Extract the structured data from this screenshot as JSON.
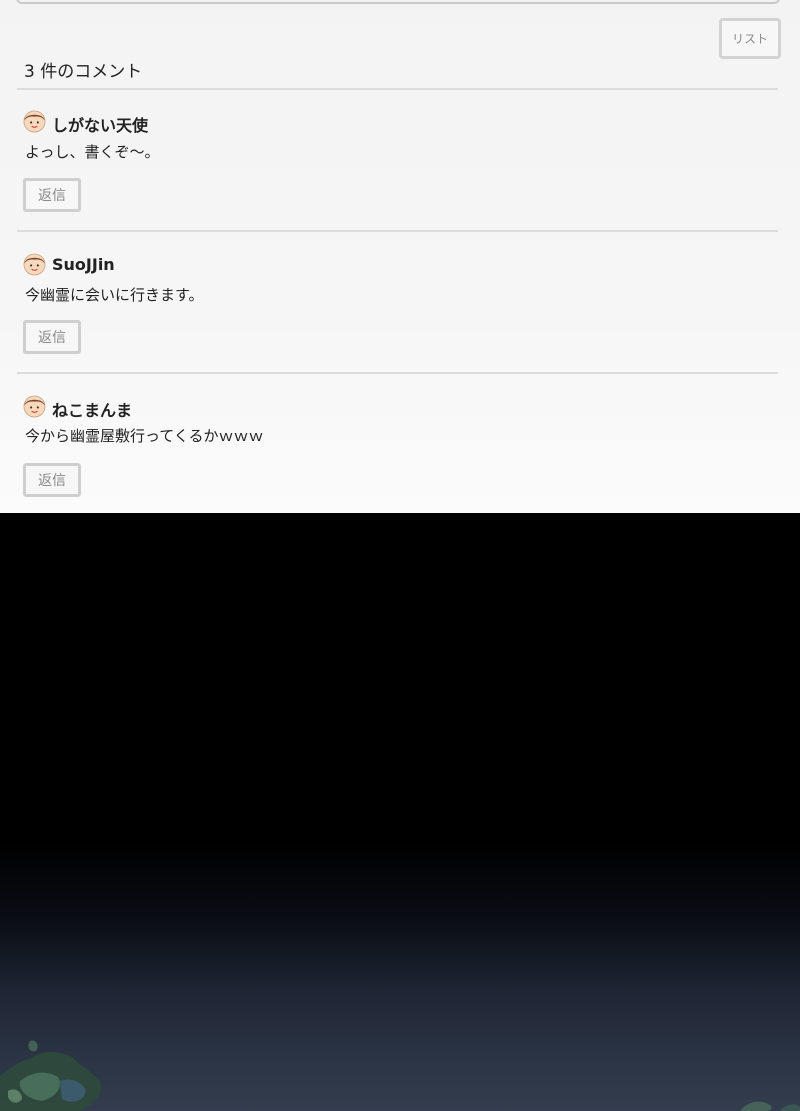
{
  "list_button_label": "リスト",
  "comment_count_title": "3 件のコメント",
  "comments": [
    {
      "author": "しがない天使",
      "text": "よっし、書くぞ〜。",
      "reply_label": "返信"
    },
    {
      "author": "SuoJJin",
      "text": "今幽霊に会いに行きます。",
      "reply_label": "返信"
    },
    {
      "author": "ねこまんま",
      "text": "今から幽霊屋敷行ってくるかｗｗｗ",
      "reply_label": "返信"
    }
  ],
  "colors": {
    "panel_background": "#f5f5f5",
    "divider": "#dcdcdc",
    "button_border": "#cfcfcf",
    "scene_background": "#000000"
  },
  "icons": {
    "avatar": "boy-face-icon"
  }
}
